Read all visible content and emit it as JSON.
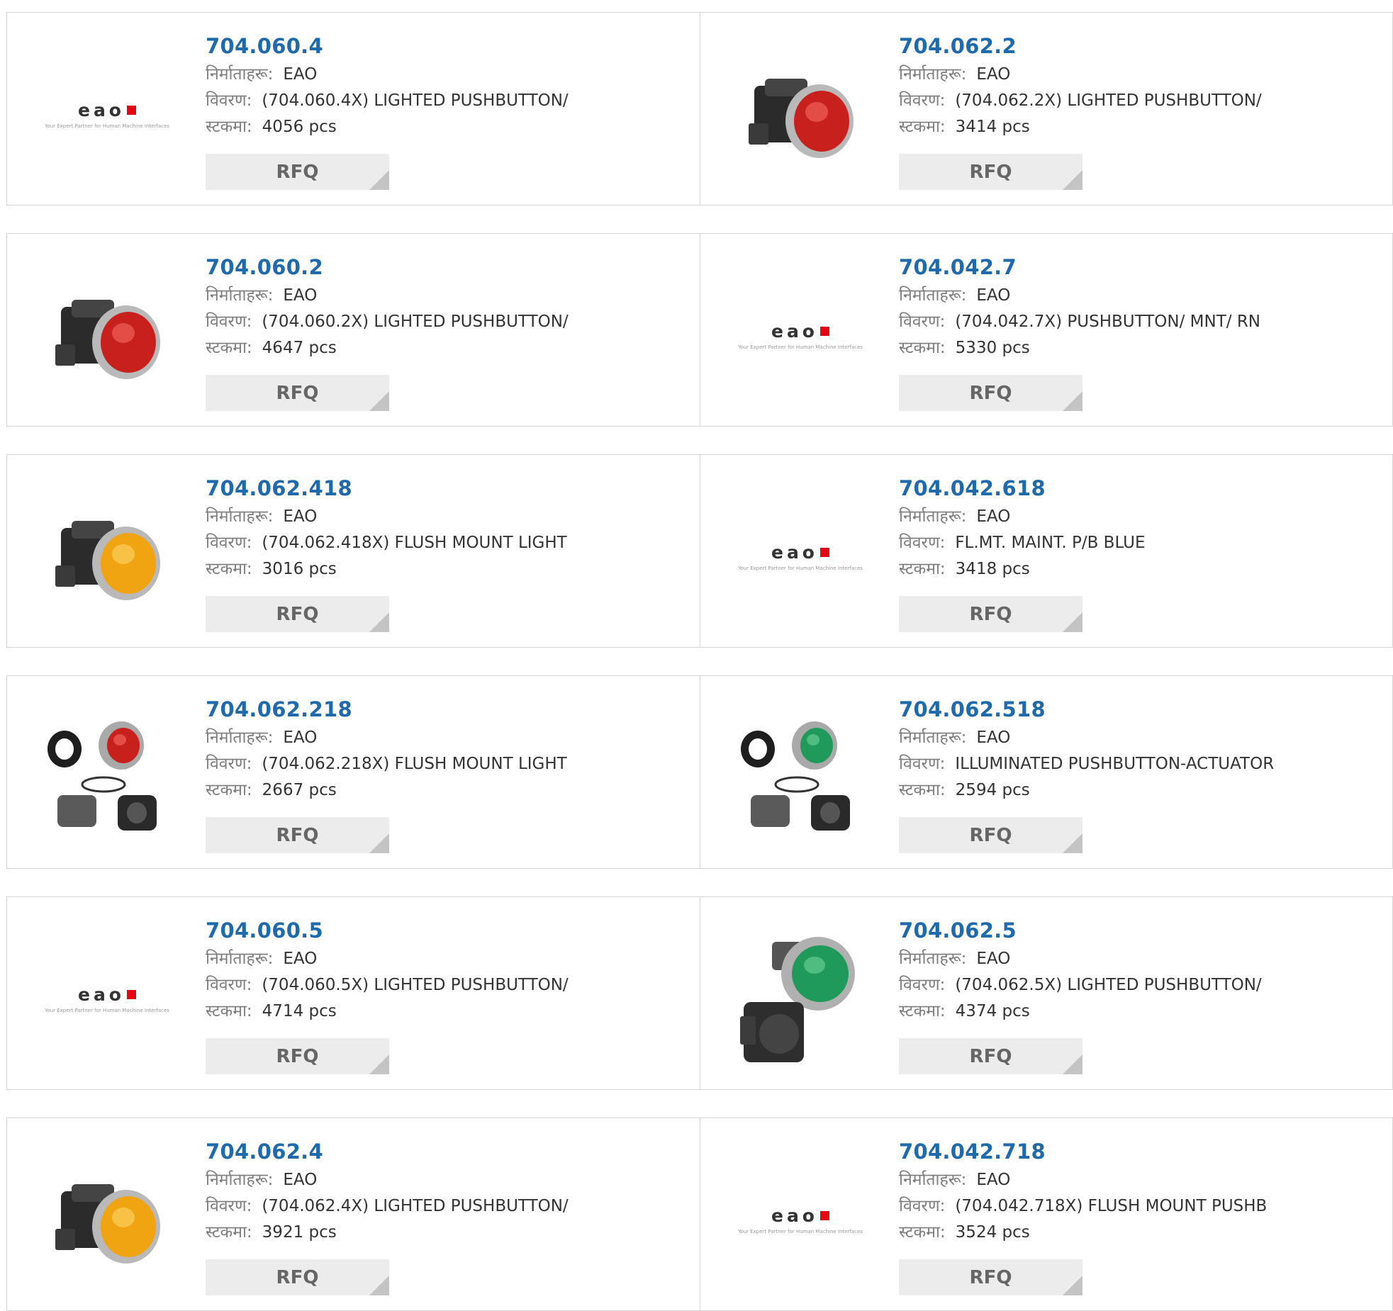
{
  "labels": {
    "manufacturer": "निर्माताहरू:",
    "description": "विवरण:",
    "stock": "स्टकमा:",
    "rfq": "RFQ"
  },
  "logo": {
    "word": "eao",
    "tagline": "Your Expert Partner for Human Machine Interfaces"
  },
  "colors": {
    "link": "#1f69ad",
    "brand_red": "#e30613",
    "rfq_bg": "#ececec"
  },
  "products": [
    {
      "part": "704.060.4",
      "manufacturer": "EAO",
      "description": "(704.060.4X) LIGHTED PUSHBUTTON/",
      "stock": "4056 pcs",
      "image": "eao-logo"
    },
    {
      "part": "704.062.2",
      "manufacturer": "EAO",
      "description": "(704.062.2X) LIGHTED PUSHBUTTON/",
      "stock": "3414 pcs",
      "image": "red-pushbutton"
    },
    {
      "part": "704.060.2",
      "manufacturer": "EAO",
      "description": "(704.060.2X) LIGHTED PUSHBUTTON/",
      "stock": "4647 pcs",
      "image": "red-pushbutton"
    },
    {
      "part": "704.042.7",
      "manufacturer": "EAO",
      "description": "(704.042.7X) PUSHBUTTON/ MNT/ RN",
      "stock": "5330 pcs",
      "image": "eao-logo"
    },
    {
      "part": "704.062.418",
      "manufacturer": "EAO",
      "description": "(704.062.418X) FLUSH MOUNT LIGHT",
      "stock": "3016 pcs",
      "image": "yellow-pushbutton"
    },
    {
      "part": "704.042.618",
      "manufacturer": "EAO",
      "description": "FL.MT. MAINT. P/B BLUE",
      "stock": "3418 pcs",
      "image": "eao-logo"
    },
    {
      "part": "704.062.218",
      "manufacturer": "EAO",
      "description": "(704.062.218X) FLUSH MOUNT LIGHT",
      "stock": "2667 pcs",
      "image": "red-pushbutton-kit"
    },
    {
      "part": "704.062.518",
      "manufacturer": "EAO",
      "description": "ILLUMINATED PUSHBUTTON-ACTUATOR",
      "stock": "2594 pcs",
      "image": "green-pushbutton-kit"
    },
    {
      "part": "704.060.5",
      "manufacturer": "EAO",
      "description": "(704.060.5X) LIGHTED PUSHBUTTON/",
      "stock": "4714 pcs",
      "image": "eao-logo"
    },
    {
      "part": "704.062.5",
      "manufacturer": "EAO",
      "description": "(704.062.5X) LIGHTED PUSHBUTTON/",
      "stock": "4374 pcs",
      "image": "green-pushbutton-exploded"
    },
    {
      "part": "704.062.4",
      "manufacturer": "EAO",
      "description": "(704.062.4X) LIGHTED PUSHBUTTON/",
      "stock": "3921 pcs",
      "image": "yellow-pushbutton"
    },
    {
      "part": "704.042.718",
      "manufacturer": "EAO",
      "description": "(704.042.718X) FLUSH MOUNT PUSHB",
      "stock": "3524 pcs",
      "image": "eao-logo"
    }
  ]
}
